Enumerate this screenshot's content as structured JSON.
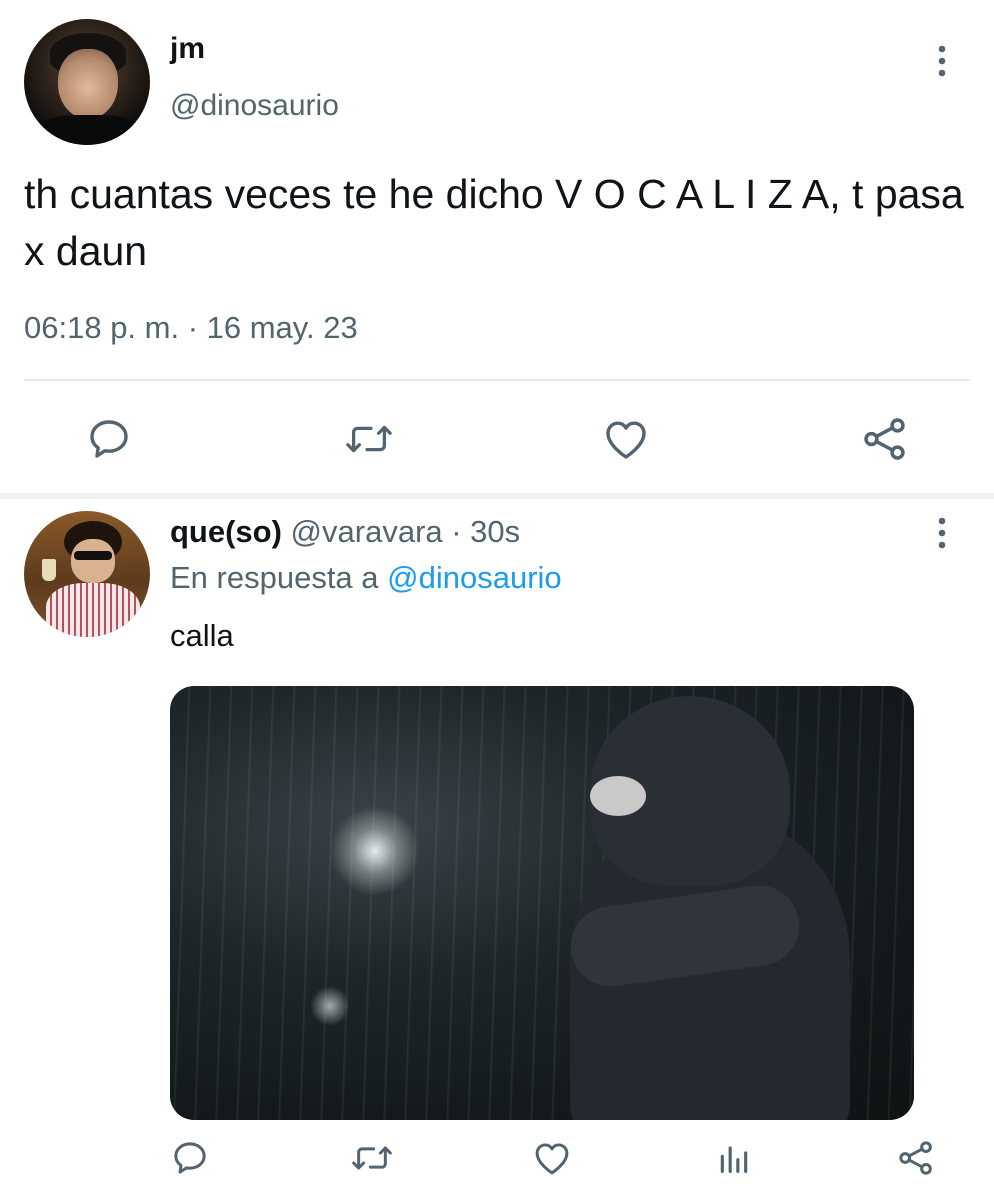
{
  "main_tweet": {
    "display_name": "jm",
    "handle": "@dinosaurio",
    "text": "th cuantas veces te he dicho V O C A L I Z A, t pasa x daun",
    "timestamp": "06:18 p. m. · 16 may. 23",
    "actions": [
      "reply-icon",
      "retweet-icon",
      "like-icon",
      "share-icon"
    ]
  },
  "reply_tweet": {
    "display_name": "que(so)",
    "handle_time": " @varavara · 30s",
    "reply_context_prefix": "En respuesta a ",
    "reply_context_mention": "@dinosaurio",
    "text": "calla",
    "actions": [
      "reply-icon",
      "retweet-icon",
      "like-icon",
      "analytics-icon",
      "share-icon"
    ]
  },
  "colors": {
    "text_primary": "#0f1419",
    "text_secondary": "#536471",
    "accent": "#1d9bf0",
    "divider": "#e6e9ec"
  }
}
